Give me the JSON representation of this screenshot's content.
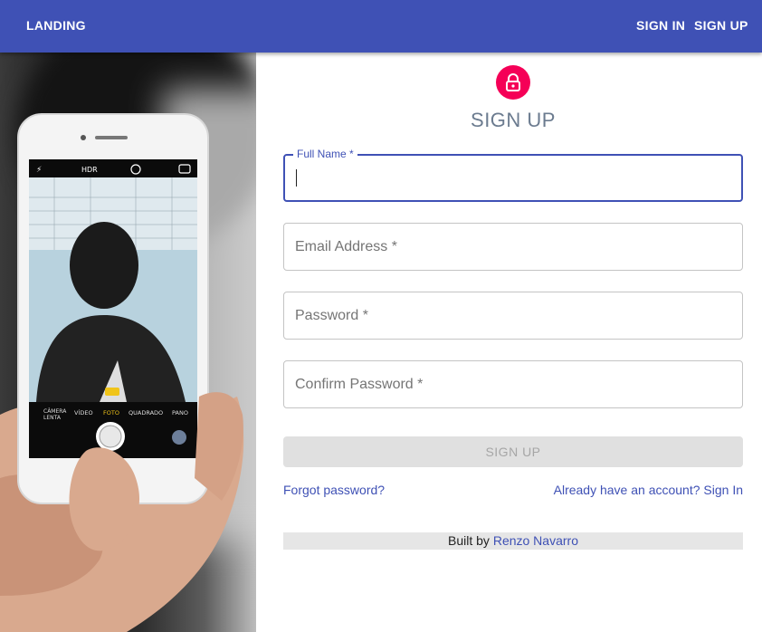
{
  "appbar": {
    "brand": "LANDING",
    "sign_in_label": "SIGN IN",
    "sign_up_label": "SIGN UP",
    "color": "#3f51b5"
  },
  "hero_image": {
    "description_icon": "phone-photo",
    "phone_toolbar": [
      "HDR"
    ],
    "phone_badge": "HDR",
    "phone_modes": [
      "CÂMERA LENTA",
      "VÍDEO",
      "FOTO",
      "QUADRADO",
      "PANO"
    ]
  },
  "form": {
    "icon": "lock-icon",
    "icon_color": "#f50057",
    "title": "SIGN UP",
    "fields": [
      {
        "label": "Full Name *",
        "placeholder": "",
        "value": ""
      },
      {
        "placeholder": "Email Address *",
        "value": ""
      },
      {
        "placeholder": "Password *",
        "value": ""
      },
      {
        "placeholder": "Confirm Password *",
        "value": ""
      }
    ],
    "submit_label": "SIGN UP",
    "forgot_password": "Forgot password?",
    "have_account": "Already have an account? Sign In"
  },
  "footer": {
    "prefix": "Built by",
    "author": "Renzo Navarro"
  }
}
